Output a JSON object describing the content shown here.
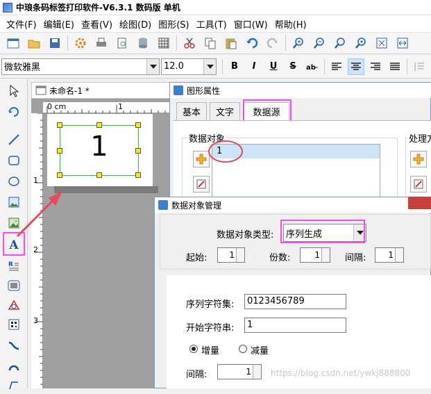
{
  "app": {
    "title": "中琅条码标签打印软件-V6.3.1 数码版 单机"
  },
  "menu": [
    "文件(F)",
    "编辑(E)",
    "查看(V)",
    "绘图(D)",
    "图形(S)",
    "工具(T)",
    "窗口(W)",
    "帮助(H)"
  ],
  "fontbar": {
    "font": "微软雅黑",
    "size": "12.0",
    "bold": "B",
    "italic": "I",
    "underline": "U",
    "strike": "S"
  },
  "document": {
    "tab": "未命名-1 *",
    "ruler_h_label": "0 cm",
    "ruler_h_tick": "1",
    "ruler_v": [
      "1",
      "2",
      "3"
    ],
    "content": "1"
  },
  "props": {
    "title": "图形属性",
    "tabs": [
      "基本",
      "文字",
      "数据源"
    ],
    "group_label": "数据对象",
    "group2_label": "处理方",
    "list_items": [
      "1"
    ]
  },
  "dom": {
    "title": "数据对象管理",
    "type_label": "数据对象类型:",
    "type_value": "序列生成",
    "start_label": "起始:",
    "start_value": "1",
    "copies_label": "份数:",
    "copies_value": "1",
    "interval_label": "间隔:",
    "interval_value": "1",
    "charset_label": "序列字符集:",
    "charset_value": "0123456789",
    "startchars_label": "开始字符串:",
    "startchars_value": "1",
    "inc_label": "增量",
    "dec_label": "减量",
    "interval2_label": "间隔:",
    "interval2_value": "1"
  },
  "watermark": "https://blog.csdn.net/ywkj888800",
  "colors": {
    "highlight": "#ff44ff",
    "annotation": "#e84a5a",
    "selection": "#22cc22",
    "handle": "#ffee00"
  }
}
